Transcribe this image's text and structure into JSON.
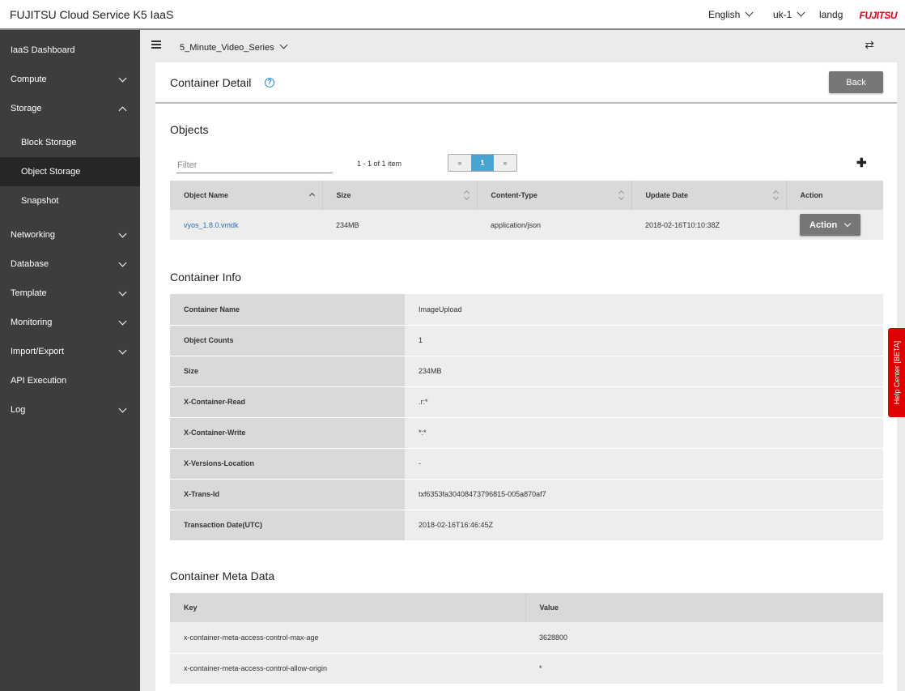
{
  "topbar": {
    "app_title": "FUJITSU Cloud Service K5 IaaS",
    "language": "English",
    "region": "uk-1",
    "user": "landg",
    "brand": "FUJITSU"
  },
  "sidebar": {
    "items": [
      {
        "label": "IaaS Dashboard"
      },
      {
        "label": "Compute"
      },
      {
        "label": "Storage"
      },
      {
        "label": "Block Storage"
      },
      {
        "label": "Object Storage"
      },
      {
        "label": "Snapshot"
      },
      {
        "label": "Networking"
      },
      {
        "label": "Database"
      },
      {
        "label": "Template"
      },
      {
        "label": "Monitoring"
      },
      {
        "label": "Import/Export"
      },
      {
        "label": "API Execution"
      },
      {
        "label": "Log"
      }
    ]
  },
  "project": {
    "name": "5_Minute_Video_Series"
  },
  "page": {
    "title": "Container Detail",
    "help_glyph": "?",
    "back_label": "Back"
  },
  "objects": {
    "title": "Objects",
    "filter_placeholder": "Filter",
    "count_text": "1 - 1 of 1 item",
    "pager": {
      "prev": "«",
      "current": "1",
      "next": "»"
    },
    "columns": [
      "Object Name",
      "Size",
      "Content-Type",
      "Update Date",
      "Action"
    ],
    "rows": [
      {
        "name": "vyos_1.8.0.vmdk",
        "size": "234MB",
        "content_type": "application/json",
        "update_date": "2018-02-16T10:10:38Z",
        "action": "Action"
      }
    ]
  },
  "container_info": {
    "title": "Container Info",
    "rows": [
      {
        "key": "Container Name",
        "value": "ImageUpload"
      },
      {
        "key": "Object Counts",
        "value": "1"
      },
      {
        "key": "Size",
        "value": "234MB"
      },
      {
        "key": "X-Container-Read",
        "value": ".r:*"
      },
      {
        "key": "X-Container-Write",
        "value": "*:*"
      },
      {
        "key": "X-Versions-Location",
        "value": "-"
      },
      {
        "key": "X-Trans-Id",
        "value": "txf6353fa30408473796815-005a870af7"
      },
      {
        "key": "Transaction Date(UTC)",
        "value": "2018-02-16T16:46:45Z"
      }
    ]
  },
  "meta_data": {
    "title": "Container Meta Data",
    "columns": [
      "Key",
      "Value"
    ],
    "rows": [
      {
        "key": "x-container-meta-access-control-max-age",
        "value": "3628800"
      },
      {
        "key": "x-container-meta-access-control-allow-origin",
        "value": "*"
      }
    ]
  },
  "help_center": {
    "label": "Help Center [BETA]"
  },
  "colors": {
    "accent": "#4aa3d0",
    "brand": "#e60012",
    "sidebar": "#3d3d3d",
    "help_center": "#dd0000"
  }
}
